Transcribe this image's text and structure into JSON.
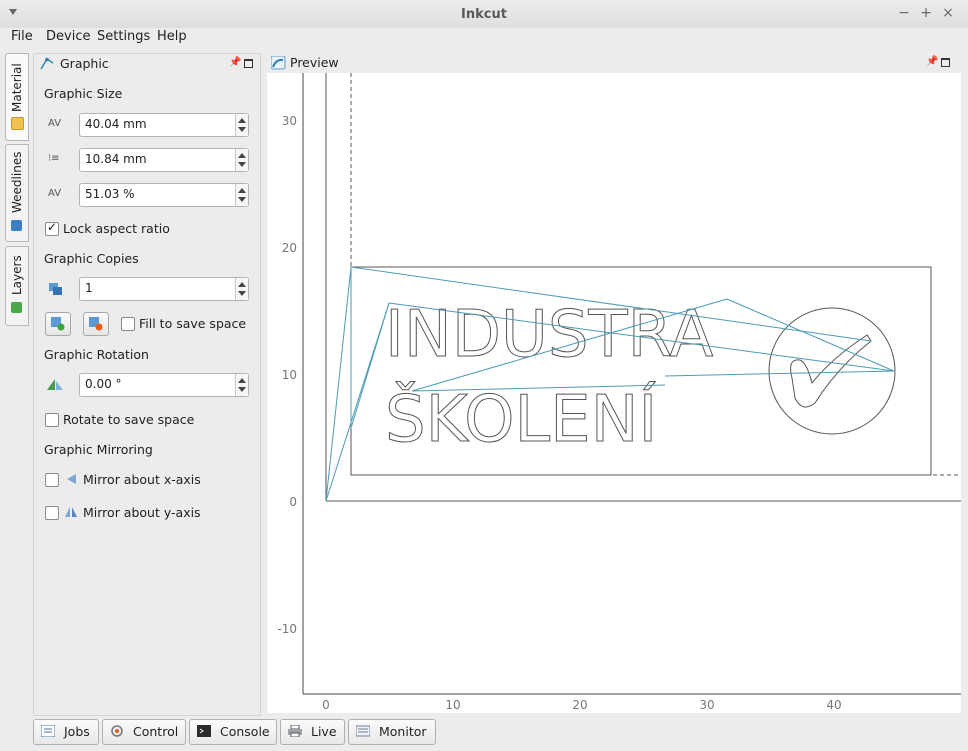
{
  "window": {
    "title": "Inkcut"
  },
  "menu": [
    "File",
    "Device",
    "Settings",
    "Help"
  ],
  "side_tabs": [
    "Material",
    "Weedlines",
    "Layers"
  ],
  "graphic_panel": {
    "title": "Graphic",
    "size_heading": "Graphic Size",
    "width": "40.04 mm",
    "height": "10.84 mm",
    "scale": "51.03 %",
    "lock_aspect": {
      "label": "Lock aspect ratio",
      "checked": true
    },
    "copies_heading": "Graphic Copies",
    "copies": "1",
    "fill_to_save": {
      "label": "Fill to save space",
      "checked": false
    },
    "rotation_heading": "Graphic Rotation",
    "rotation": "0.00 °",
    "rotate_to_save": {
      "label": "Rotate to save space",
      "checked": false
    },
    "mirroring_heading": "Graphic Mirroring",
    "mirror_x": {
      "label": "Mirror about x-axis",
      "checked": false
    },
    "mirror_y": {
      "label": "Mirror about y-axis",
      "checked": false
    }
  },
  "preview": {
    "title": "Preview",
    "graphic_text_line1": "INDUSTRA",
    "graphic_text_line2": "ŠKOLENÍ",
    "x_ticks": [
      "0",
      "10",
      "20",
      "30",
      "40"
    ],
    "y_ticks": [
      "30",
      "20",
      "10",
      "0",
      "-10"
    ]
  },
  "bottom_tabs": [
    "Jobs",
    "Control",
    "Console",
    "Live",
    "Monitor"
  ],
  "colors": {
    "accent": "#2c7fb8",
    "path": "#4a9bb5",
    "outline": "#555555"
  }
}
